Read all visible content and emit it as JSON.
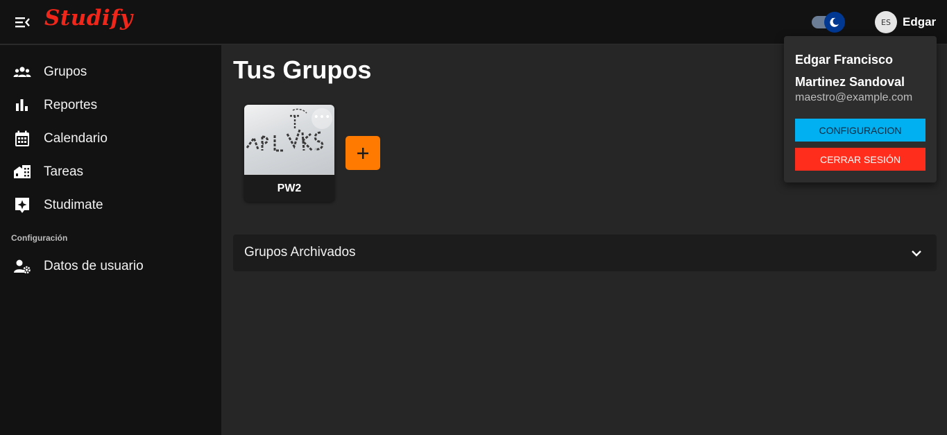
{
  "app": {
    "logo_text": "Studify",
    "user_name": "Edgar",
    "avatar_initials": "ES"
  },
  "sidebar": {
    "items": [
      {
        "label": "Grupos",
        "icon": "groups-icon"
      },
      {
        "label": "Reportes",
        "icon": "bar-chart-icon"
      },
      {
        "label": "Calendario",
        "icon": "calendar-icon"
      },
      {
        "label": "Tareas",
        "icon": "tasks-icon"
      },
      {
        "label": "Studimate",
        "icon": "sparkle-icon"
      }
    ],
    "section_title": "Configuración",
    "config_items": [
      {
        "label": "Datos de usuario",
        "icon": "user-settings-icon"
      }
    ]
  },
  "main": {
    "title": "Tus Grupos",
    "groups": [
      {
        "name": "PW2"
      }
    ],
    "archived_label": "Grupos Archivados"
  },
  "user_menu": {
    "name_line1": "Edgar Francisco",
    "name_line2": "Martinez Sandoval",
    "email": "maestro@example.com",
    "config_label": "CONFIGURACION",
    "logout_label": "CERRAR SESIÓN"
  },
  "colors": {
    "accent_orange": "#ff7a00",
    "config_blue": "#00b0f0",
    "logout_red": "#ff2e1c",
    "logo_red": "#f0261a",
    "toggle_blue": "#003892"
  }
}
